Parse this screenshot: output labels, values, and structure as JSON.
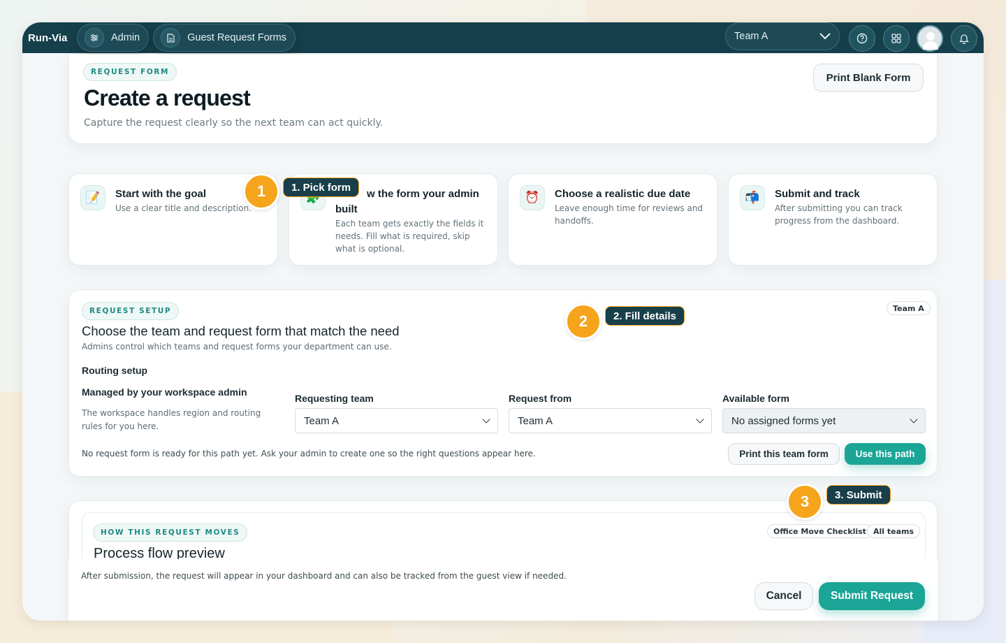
{
  "app": {
    "brand": "Run-Via"
  },
  "topbar": {
    "breadcrumbs": [
      {
        "label": "Admin",
        "icon": "sliders-icon"
      },
      {
        "label": "Guest Request Forms",
        "icon": "document-icon"
      }
    ],
    "team_select": "Team A",
    "buttons": [
      "help-icon",
      "apps-grid-icon",
      "avatar",
      "bell-icon"
    ]
  },
  "header": {
    "tag": "REQUEST FORM",
    "title": "Create a request",
    "subtitle": "Capture the request clearly so the next team can act quickly.",
    "print_blank": "Print Blank Form"
  },
  "steps": [
    {
      "icon": "📝",
      "title": "Start with the goal",
      "desc": "Use a clear title and description."
    },
    {
      "icon": "🧩",
      "title": "w the form your admin built",
      "desc": "Each team gets exactly the fields it needs. Fill what is required, skip what is optional."
    },
    {
      "icon": "⏰",
      "title": "Choose a realistic due date",
      "desc": "Leave enough time for reviews and handoffs."
    },
    {
      "icon": "📬",
      "title": "Submit and track",
      "desc": "After submitting you can track progress from the dashboard."
    }
  ],
  "setup": {
    "tag": "REQUEST SETUP",
    "team_badge": "Team A",
    "title": "Choose the team and request form that match the need",
    "subtitle": "Admins control which teams and request forms your department can use.",
    "routing_heading": "Routing setup",
    "managed_title": "Managed by your workspace admin",
    "managed_desc": "The workspace handles region and routing rules for you here.",
    "requesting_team_label": "Requesting team",
    "requesting_team_value": "Team A",
    "request_from_label": "Request from",
    "request_from_value": "Team A",
    "available_form_label": "Available form",
    "available_form_value": "No assigned forms yet",
    "notice": "No request form is ready for this path yet. Ask your admin to create one so the right questions appear here.",
    "print_team_form": "Print this team form",
    "use_path": "Use this path"
  },
  "flow": {
    "tag": "HOW THIS REQUEST MOVES",
    "title": "Process flow preview",
    "chips": [
      "Office Move Checklist",
      "All teams"
    ],
    "footer_note": "After submission, the request will appear in your dashboard and can also be tracked from the guest view if needed.",
    "cancel": "Cancel",
    "submit": "Submit Request"
  },
  "guide": {
    "markers": [
      "1",
      "2",
      "3"
    ],
    "callouts": [
      "1. Pick form",
      "2. Fill details",
      "3. Submit"
    ],
    "marker_color": "#f5a41c"
  }
}
